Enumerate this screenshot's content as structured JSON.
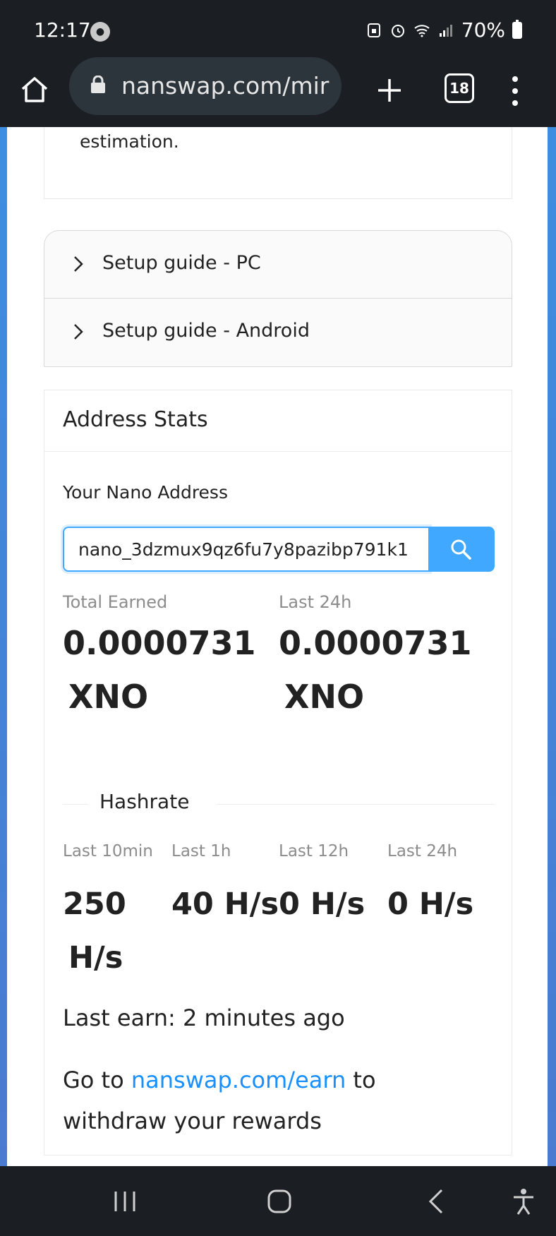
{
  "status_bar": {
    "time": "12:17",
    "battery": "70%"
  },
  "browser": {
    "url": "nanswap.com/mir",
    "tab_count": "18"
  },
  "page": {
    "intro_text": "estimation.",
    "guides": [
      {
        "label": "Setup guide - PC"
      },
      {
        "label": "Setup guide - Android"
      }
    ],
    "stats": {
      "title": "Address Stats",
      "address_label": "Your Nano Address",
      "address_value": "nano_3dzmux9qz6fu7y8pazibp791k1",
      "total_earned_label": "Total Earned",
      "total_earned_amount": "0.0000731",
      "total_earned_unit": "XNO",
      "last24_label": "Last 24h",
      "last24_amount": "0.0000731",
      "last24_unit": "XNO",
      "hashrate_title": "Hashrate",
      "hashrate": [
        {
          "label": "Last 10min",
          "value": "250",
          "unit": "H/s"
        },
        {
          "label": "Last 1h",
          "value": "40 H/s"
        },
        {
          "label": "Last 12h",
          "value": "0 H/s"
        },
        {
          "label": "Last 24h",
          "value": "0 H/s"
        }
      ],
      "last_earn": "Last earn: 2 minutes ago",
      "withdraw_prefix": "Go to ",
      "withdraw_link": "nanswap.com/earn",
      "withdraw_suffix": " to withdraw your rewards"
    }
  },
  "colors": {
    "accent": "#40a9ff",
    "link": "#1890ff",
    "chrome_bg": "#1b1f24"
  }
}
